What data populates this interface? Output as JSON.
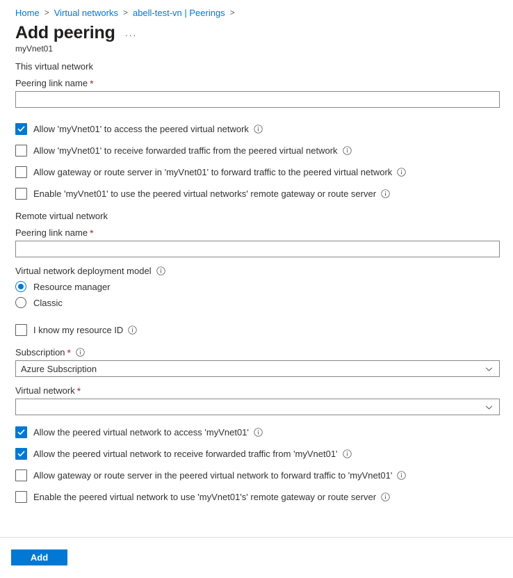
{
  "breadcrumb": {
    "items": [
      {
        "label": "Home"
      },
      {
        "label": "Virtual networks"
      },
      {
        "label": "abell-test-vn | Peerings"
      }
    ],
    "separator": ">"
  },
  "header": {
    "title": "Add peering",
    "ellipsis": "···",
    "subtitle": "myVnet01"
  },
  "local_section": {
    "heading": "This virtual network",
    "peering_link_name": {
      "label": "Peering link name",
      "required": "*",
      "value": "",
      "placeholder": ""
    },
    "checkboxes": [
      {
        "label": "Allow 'myVnet01' to access the peered virtual network",
        "checked": true,
        "has_info": true
      },
      {
        "label": "Allow 'myVnet01' to receive forwarded traffic from the peered virtual network",
        "checked": false,
        "has_info": true
      },
      {
        "label": "Allow gateway or route server in 'myVnet01' to forward traffic to the peered virtual network",
        "checked": false,
        "has_info": true
      },
      {
        "label": "Enable 'myVnet01' to use the peered virtual networks' remote gateway or route server",
        "checked": false,
        "has_info": true
      }
    ]
  },
  "remote_section": {
    "heading": "Remote virtual network",
    "peering_link_name": {
      "label": "Peering link name",
      "required": "*",
      "value": "",
      "placeholder": ""
    },
    "deployment_model": {
      "label": "Virtual network deployment model",
      "has_info": true,
      "options": [
        {
          "label": "Resource manager",
          "selected": true
        },
        {
          "label": "Classic",
          "selected": false
        }
      ]
    },
    "resource_id_checkbox": {
      "label": "I know my resource ID",
      "checked": false,
      "has_info": true
    },
    "subscription": {
      "label": "Subscription",
      "required": "*",
      "has_info": true,
      "value": "Azure Subscription"
    },
    "virtual_network": {
      "label": "Virtual network",
      "required": "*",
      "has_info": false,
      "value": ""
    },
    "checkboxes": [
      {
        "label": "Allow the peered virtual network to access 'myVnet01'",
        "checked": true,
        "has_info": true
      },
      {
        "label": "Allow the peered virtual network to receive forwarded traffic from 'myVnet01'",
        "checked": true,
        "has_info": true
      },
      {
        "label": "Allow gateway or route server in the peered virtual network to forward traffic to 'myVnet01'",
        "checked": false,
        "has_info": true
      },
      {
        "label": "Enable the peered virtual network to use 'myVnet01's' remote gateway or route server",
        "checked": false,
        "has_info": true
      }
    ]
  },
  "footer": {
    "add_label": "Add"
  },
  "colors": {
    "accent": "#0078d4",
    "link": "#0078d4",
    "required": "#a4262c",
    "text": "#323130",
    "border": "#8a8886"
  }
}
